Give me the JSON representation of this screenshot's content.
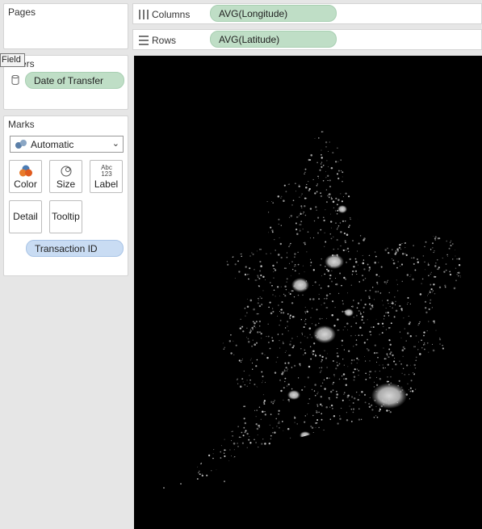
{
  "pages": {
    "title": "Pages"
  },
  "filters": {
    "title": "Filters",
    "tooltip": "Field",
    "items": [
      {
        "label": "Date of Transfer"
      }
    ]
  },
  "marks": {
    "title": "Marks",
    "mark_type": "Automatic",
    "buttons": {
      "color": "Color",
      "size": "Size",
      "label": "Label",
      "label_icon_text": "Abc\n123",
      "detail": "Detail",
      "tooltip": "Tooltip"
    },
    "fields": [
      {
        "label": "Transaction ID"
      }
    ]
  },
  "columns": {
    "label": "Columns",
    "pill": "AVG(Longitude)"
  },
  "rows": {
    "label": "Rows",
    "pill": "AVG(Latitude)"
  },
  "colors": {
    "background": "#000000",
    "marks": "#d9d9d9",
    "green_pill": "#bfdec6",
    "blue_pill": "#c9dcf3"
  }
}
